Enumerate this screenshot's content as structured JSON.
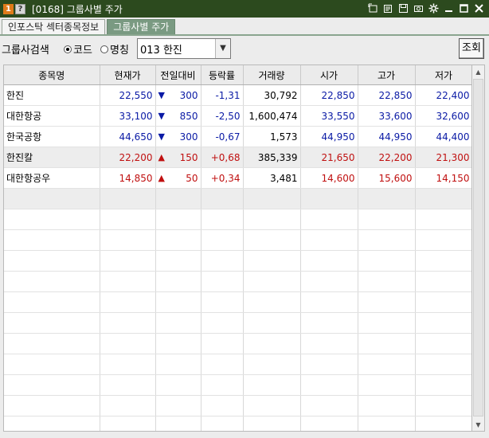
{
  "window": {
    "badge_num": "1",
    "badge_help": "?",
    "title": "[0168] 그룹사별 주가",
    "icons": [
      "new-window-icon",
      "memo-icon",
      "save-icon",
      "camera-icon",
      "settings-icon",
      "minimize-icon",
      "maximize-icon",
      "close-icon"
    ]
  },
  "tabs": [
    {
      "label": "인포스탁 섹터종목정보",
      "active": false
    },
    {
      "label": "그룹사별 주가",
      "active": true
    }
  ],
  "search": {
    "label": "그룹사검색",
    "radio_code": "코드",
    "radio_name": "명칭",
    "selected_mode": "코드",
    "combo_value": "013 한진",
    "query_button": "조회"
  },
  "table": {
    "headers": [
      "종목명",
      "현재가",
      "전일대비",
      "등락률",
      "거래량",
      "시가",
      "고가",
      "저가"
    ],
    "rows": [
      {
        "name": "한진",
        "price": "22,550",
        "dir": "down",
        "change": "300",
        "rate": "-1,31",
        "volume": "30,792",
        "open": "22,850",
        "high": "22,850",
        "low": "22,400"
      },
      {
        "name": "대한항공",
        "price": "33,100",
        "dir": "down",
        "change": "850",
        "rate": "-2,50",
        "volume": "1,600,474",
        "open": "33,550",
        "high": "33,600",
        "low": "32,600"
      },
      {
        "name": "한국공항",
        "price": "44,650",
        "dir": "down",
        "change": "300",
        "rate": "-0,67",
        "volume": "1,573",
        "open": "44,950",
        "high": "44,950",
        "low": "44,400"
      },
      {
        "name": "한진칼",
        "price": "22,200",
        "dir": "up",
        "change": "150",
        "rate": "+0,68",
        "volume": "385,339",
        "open": "21,650",
        "high": "22,200",
        "low": "21,300"
      },
      {
        "name": "대한항공우",
        "price": "14,850",
        "dir": "up",
        "change": "50",
        "rate": "+0,34",
        "volume": "3,481",
        "open": "14,600",
        "high": "15,600",
        "low": "14,150"
      }
    ],
    "colors": {
      "down": "#0a1aa5",
      "up": "#c01010"
    }
  }
}
